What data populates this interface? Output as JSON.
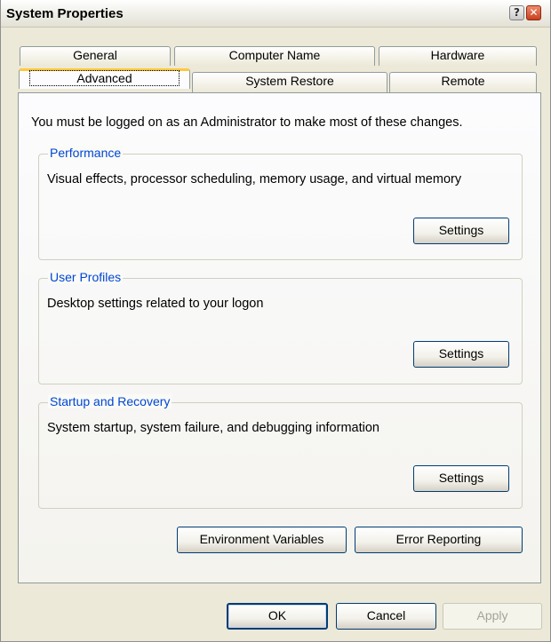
{
  "window": {
    "title": "System Properties"
  },
  "titlebar": {
    "help_glyph": "?",
    "close_glyph": "✕"
  },
  "tabs": {
    "row1": [
      "General",
      "Computer Name",
      "Hardware"
    ],
    "row2": [
      "Advanced",
      "System Restore",
      "Remote"
    ],
    "active": "Advanced"
  },
  "advanced": {
    "admin_note": "You must be logged on as an Administrator to make most of these changes.",
    "performance": {
      "title": "Performance",
      "description": "Visual effects, processor scheduling, memory usage, and virtual memory",
      "button": "Settings"
    },
    "user_profiles": {
      "title": "User Profiles",
      "description": "Desktop settings related to your logon",
      "button": "Settings"
    },
    "startup_recovery": {
      "title": "Startup and Recovery",
      "description": "System startup, system failure, and debugging information",
      "button": "Settings"
    },
    "env_button": "Environment Variables",
    "error_button": "Error Reporting"
  },
  "footer": {
    "ok": "OK",
    "cancel": "Cancel",
    "apply": "Apply"
  },
  "colors": {
    "accent_group_title": "#0046d5",
    "dialog_bg": "#ece9d8",
    "active_tab_highlight": "#ffc83c"
  }
}
